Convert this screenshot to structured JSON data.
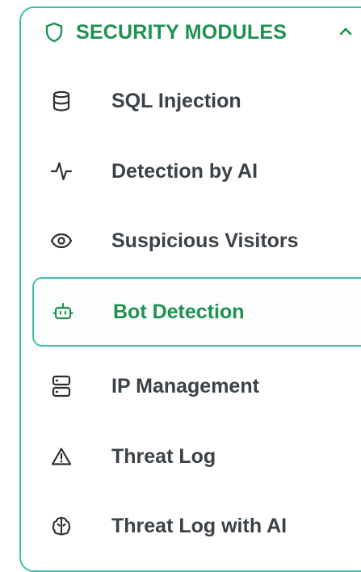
{
  "section": {
    "title": "SECURITY MODULES",
    "icon": "shield-icon",
    "toggle_icon": "chevron-up-icon",
    "accent_color": "#1e9150",
    "border_color": "#3fc1a7"
  },
  "items": [
    {
      "label": "SQL Injection",
      "icon": "database-icon"
    },
    {
      "label": "Detection by AI",
      "icon": "activity-icon"
    },
    {
      "label": "Suspicious Visitors",
      "icon": "eye-icon"
    },
    {
      "label": "Bot Detection",
      "icon": "bot-icon",
      "active": true
    },
    {
      "label": "IP Management",
      "icon": "server-icon"
    },
    {
      "label": "Threat Log",
      "icon": "warning-triangle-icon"
    },
    {
      "label": "Threat Log with AI",
      "icon": "brain-icon"
    }
  ]
}
